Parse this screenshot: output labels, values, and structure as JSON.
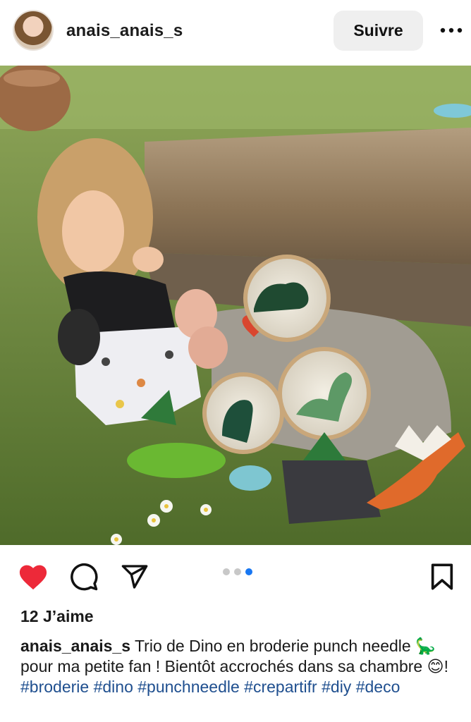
{
  "post": {
    "username": "anais_anais_s",
    "follow_label": "Suivre",
    "likes_text": "12 J’aime",
    "caption_user": "anais_anais_s",
    "caption_text": " Trio de Dino en broderie punch needle 🦕 pour ma petite fan ! Bientôt accrochés dans sa chambre 😊! ",
    "hashtags": [
      "#broderie",
      "#dino",
      "#punchneedle",
      "#crepartifr",
      "#diy",
      "#deco"
    ]
  },
  "carousel": {
    "count": 3,
    "active_index": 2
  },
  "icons": {
    "more": "more-horizontal-icon",
    "like": "heart-filled-icon",
    "comment": "comment-icon",
    "share": "send-icon",
    "save": "bookmark-icon"
  },
  "colors": {
    "like": "#ed2939",
    "hashtag": "#1f4f8f",
    "active_dot": "#1877f2"
  }
}
